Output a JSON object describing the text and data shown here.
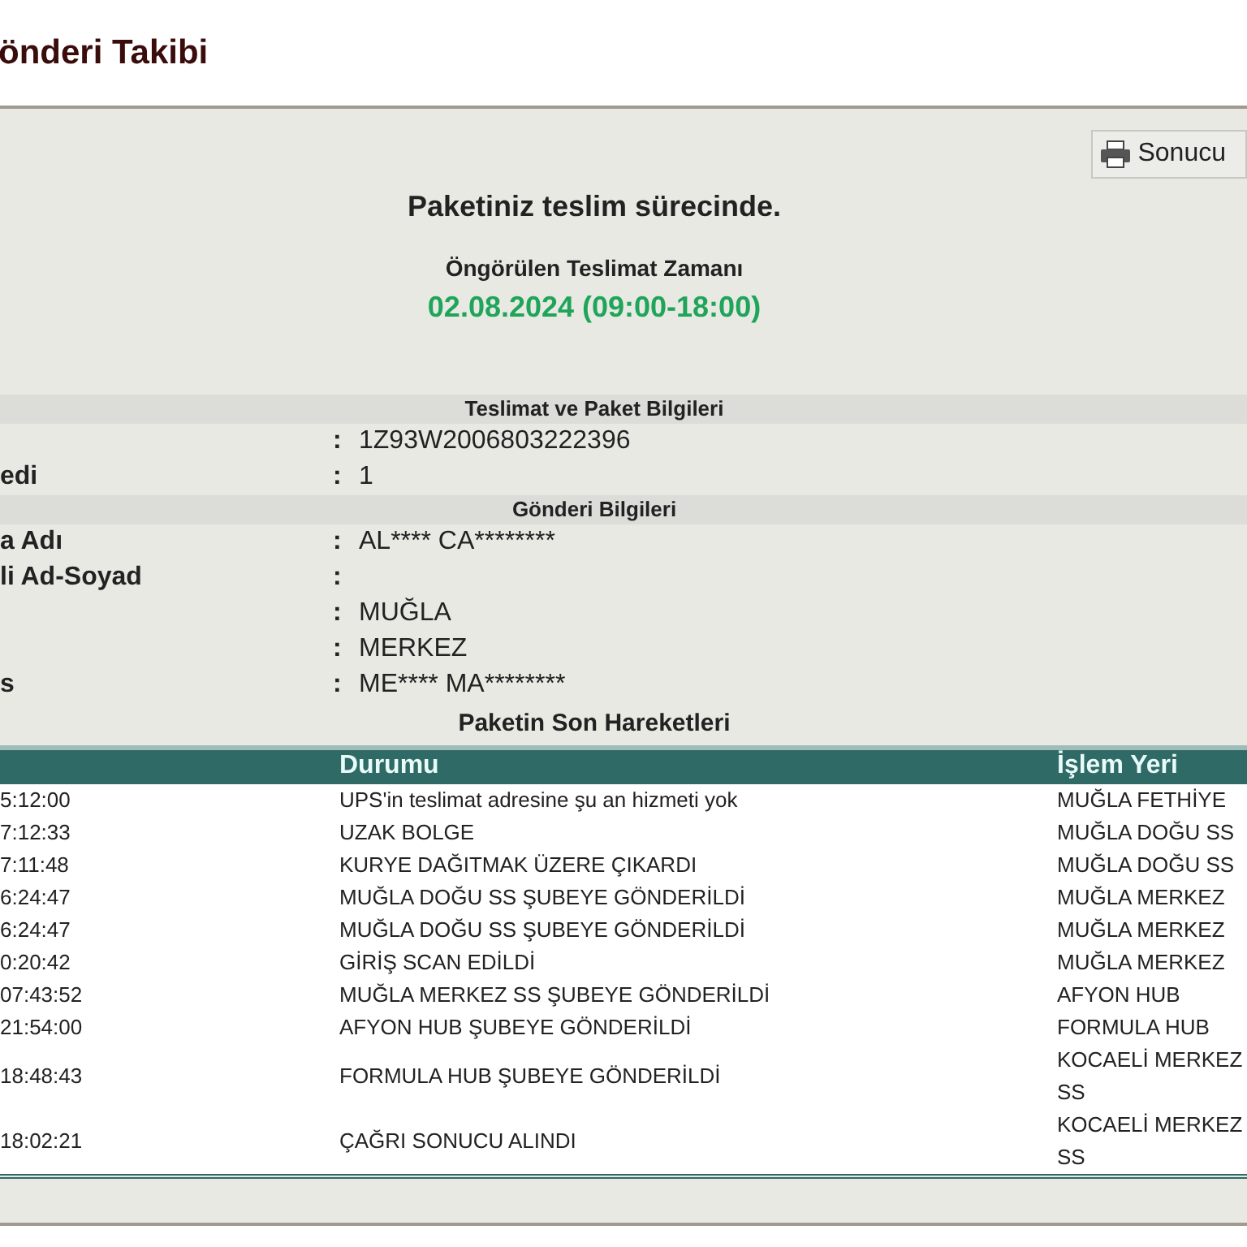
{
  "page_title": "önderi Takibi",
  "print_button": {
    "label": "Sonucu"
  },
  "status": {
    "headline": "Paketiniz teslim sürecinde.",
    "eta_label": "Öngörülen Teslimat Zamanı",
    "eta_value": "02.08.2024 (09:00-18:00)"
  },
  "sections": [
    {
      "title": "Teslimat ve Paket Bilgileri",
      "rows": [
        {
          "label": "",
          "separator": ":",
          "value": "1Z93W2006803222396"
        },
        {
          "label": "edi",
          "separator": ":",
          "value": "1"
        }
      ]
    },
    {
      "title": "Gönderi Bilgileri",
      "rows": [
        {
          "label": "a Adı",
          "separator": ":",
          "value": "AL**** CA********"
        },
        {
          "label": "li Ad-Soyad",
          "separator": ":",
          "value": ""
        },
        {
          "label": "",
          "separator": ":",
          "value": "MUĞLA"
        },
        {
          "label": "",
          "separator": ":",
          "value": "MERKEZ"
        },
        {
          "label": "s",
          "separator": ":",
          "value": "ME**** MA********"
        }
      ]
    }
  ],
  "movements": {
    "title": "Paketin Son Hareketleri",
    "columns": [
      "",
      "Durumu",
      "İşlem Yeri"
    ],
    "rows": [
      [
        "5:12:00",
        "UPS'in teslimat adresine şu an hizmeti yok",
        "MUĞLA FETHİYE"
      ],
      [
        "7:12:33",
        "UZAK BOLGE",
        "MUĞLA DOĞU SS"
      ],
      [
        "7:11:48",
        "KURYE DAĞITMAK ÜZERE ÇIKARDI",
        "MUĞLA DOĞU SS"
      ],
      [
        "6:24:47",
        "MUĞLA DOĞU SS ŞUBEYE GÖNDERİLDİ",
        "MUĞLA MERKEZ"
      ],
      [
        "6:24:47",
        "MUĞLA DOĞU SS ŞUBEYE GÖNDERİLDİ",
        "MUĞLA MERKEZ"
      ],
      [
        "0:20:42",
        "GİRİŞ SCAN EDİLDİ",
        "MUĞLA MERKEZ"
      ],
      [
        "07:43:52",
        "MUĞLA MERKEZ SS ŞUBEYE GÖNDERİLDİ",
        "AFYON HUB"
      ],
      [
        "21:54:00",
        "AFYON HUB ŞUBEYE GÖNDERİLDİ",
        "FORMULA HUB"
      ],
      [
        "18:48:43",
        "FORMULA HUB ŞUBEYE GÖNDERİLDİ",
        "KOCAELİ MERKEZ SS"
      ],
      [
        "18:02:21",
        "ÇAĞRI SONUCU ALINDI",
        "KOCAELİ MERKEZ SS"
      ]
    ]
  }
}
